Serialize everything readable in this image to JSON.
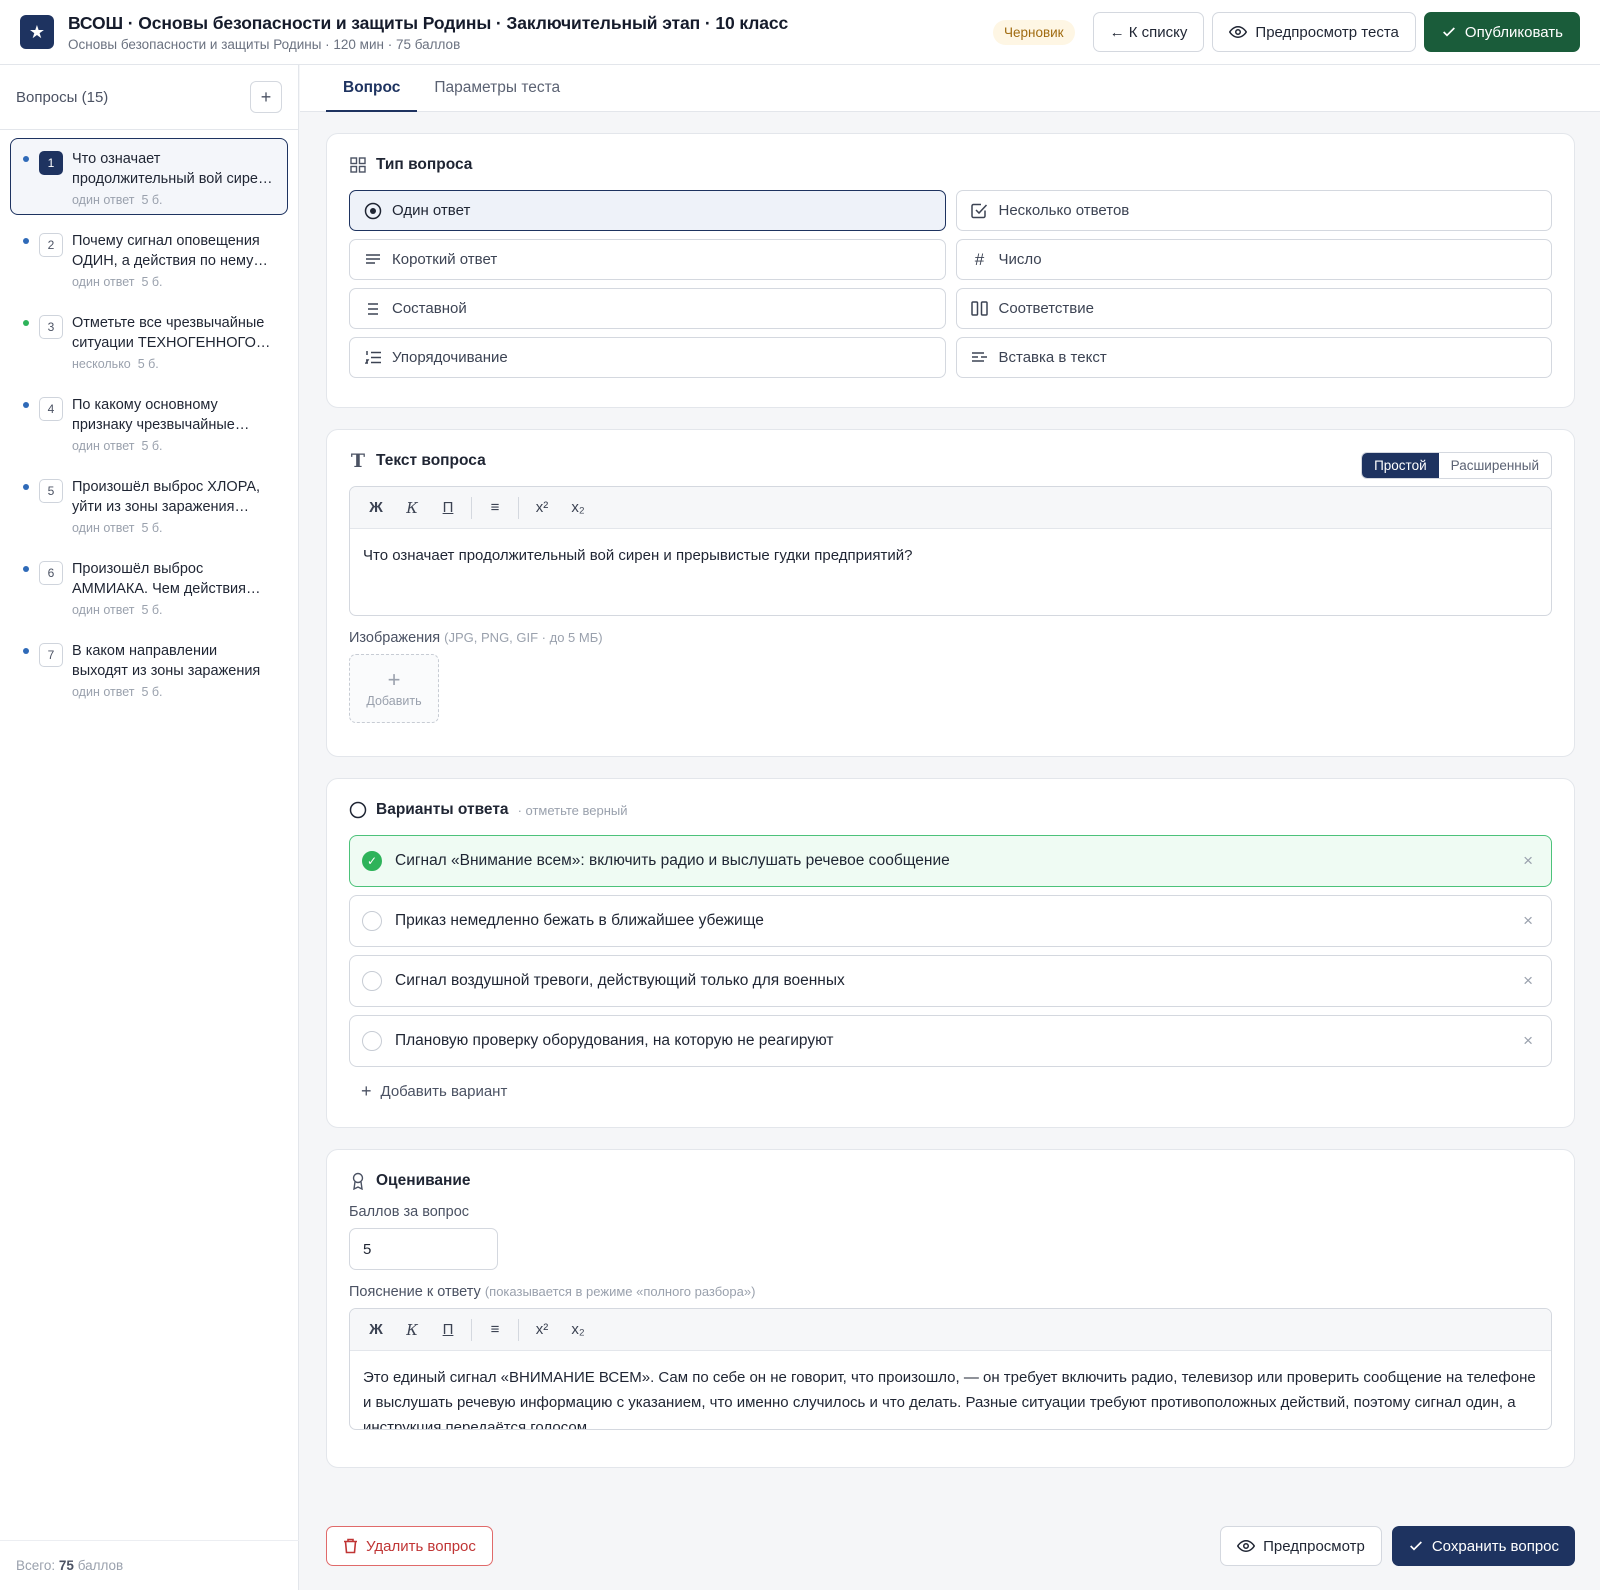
{
  "header": {
    "title": "ВСОШ · Основы безопасности и защиты Родины · Заключительный этап · 10 класс",
    "subtitle": "Основы безопасности и защиты Родины · 120 мин · 75 баллов",
    "status_badge": "Черновик",
    "back_label": "← К списку",
    "preview_label": "Предпросмотр теста",
    "publish_label": "Опубликовать"
  },
  "sidebar": {
    "title": "Вопросы (15)",
    "add_icon": "plus-icon",
    "items": [
      {
        "num": "1",
        "title": "Что означает продолжительный вой сирен и прерывистые гудки предприятий?",
        "type": "один ответ",
        "points": "5 б.",
        "dot": "#2f6ab8"
      },
      {
        "num": "2",
        "title": "Почему сигнал оповещения ОДИН, а действия по нему разные?",
        "type": "один ответ",
        "points": "5 б.",
        "dot": "#2f6ab8"
      },
      {
        "num": "3",
        "title": "Отметьте все чрезвычайные ситуации ТЕХНОГЕННОГО характера",
        "type": "несколько",
        "points": "5 б.",
        "dot": "#2eb35a"
      },
      {
        "num": "4",
        "title": "По какому основному признаку чрезвычайные ситуации делятся",
        "type": "один ответ",
        "points": "5 б.",
        "dot": "#2f6ab8"
      },
      {
        "num": "5",
        "title": "Произошёл выброс ХЛОРА, уйти из зоны заражения нужно",
        "type": "один ответ",
        "points": "5 б.",
        "dot": "#2f6ab8"
      },
      {
        "num": "6",
        "title": "Произошёл выброс АММИАКА. Чем действия отличаются",
        "type": "один ответ",
        "points": "5 б.",
        "dot": "#2f6ab8"
      },
      {
        "num": "7",
        "title": "В каком направлении выходят из зоны заражения",
        "type": "один ответ",
        "points": "5 б.",
        "dot": "#2f6ab8"
      }
    ],
    "footer_prefix": "Всего: ",
    "footer_total": "75",
    "footer_suffix": " баллов"
  },
  "tabs": [
    {
      "label": "Вопрос",
      "active": true
    },
    {
      "label": "Параметры теста",
      "active": false
    }
  ],
  "question_type": {
    "title": "Тип вопроса",
    "icon": "grid-icon",
    "options": [
      {
        "label": "Один ответ",
        "icon": "radio-target-icon",
        "active": true
      },
      {
        "label": "Несколько ответов",
        "icon": "checkbox-icon",
        "active": false
      },
      {
        "label": "Короткий ответ",
        "icon": "lines-icon",
        "active": false
      },
      {
        "label": "Число",
        "icon": "hash-icon",
        "active": false
      },
      {
        "label": "Составной",
        "icon": "list-icon",
        "active": false
      },
      {
        "label": "Соответствие",
        "icon": "columns-icon",
        "active": false
      },
      {
        "label": "Упорядочивание",
        "icon": "ordered-list-icon",
        "active": false
      },
      {
        "label": "Вставка в текст",
        "icon": "text-insert-icon",
        "active": false
      }
    ]
  },
  "question_text": {
    "title": "Текст вопроса",
    "icon": "text-icon",
    "mode_simple": "Простой",
    "mode_advanced": "Расширенный",
    "toolbar": {
      "bold": "Ж",
      "italic": "К",
      "underline": "П",
      "list": "≡",
      "sup": "x²",
      "sub": "x₂"
    },
    "body": "Что означает продолжительный вой сирен и прерывистые гудки предприятий?",
    "images_label": "Изображения",
    "images_hint": "(JPG, PNG, GIF · до 5 МБ)",
    "images_add": "Добавить"
  },
  "answers": {
    "title": "Варианты ответа",
    "hint": "· отметьте верный",
    "icon": "radio-empty-icon",
    "items": [
      {
        "text": "Сигнал «Внимание всем»: включить радио и выслушать речевое сообщение",
        "correct": true
      },
      {
        "text": "Приказ немедленно бежать в ближайшее убежище",
        "correct": false
      },
      {
        "text": "Сигнал воздушной тревоги, действующий только для военных",
        "correct": false
      },
      {
        "text": "Плановую проверку оборудования, на которую не реагируют",
        "correct": false
      }
    ],
    "add_label": "Добавить вариант"
  },
  "grading": {
    "title": "Оценивание",
    "icon": "award-icon",
    "points_label": "Баллов за вопрос",
    "points_value": "5",
    "explanation_label": "Пояснение к ответу",
    "explanation_hint": "(показывается в режиме «полного разбора»)",
    "explanation": "Это единый сигнал «ВНИМАНИЕ ВСЕМ». Сам по себе он не говорит, что произошло, — он требует включить радио, телевизор или проверить сообщение на телефоне и выслушать речевую информацию с указанием, что именно случилось и что делать. Разные ситуации требуют противоположных действий, поэтому сигнал один, а инструкция передаётся голосом."
  },
  "footer": {
    "delete_label": "Удалить вопрос",
    "preview_label": "Предпросмотр",
    "save_label": "Сохранить вопрос"
  },
  "colors": {
    "brand": "#1e3360",
    "publish": "#1a5c3a",
    "correct": "#2eb35a",
    "danger": "#c03535"
  }
}
